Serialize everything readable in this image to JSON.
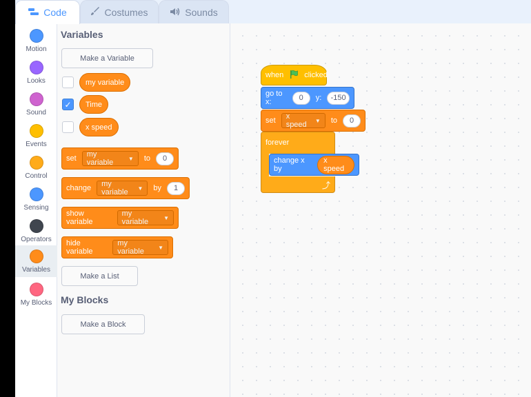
{
  "tabs": [
    {
      "label": "Code",
      "icon": "code-icon",
      "active": true
    },
    {
      "label": "Costumes",
      "icon": "brush-icon",
      "active": false
    },
    {
      "label": "Sounds",
      "icon": "speaker-icon",
      "active": false
    }
  ],
  "categories": [
    {
      "label": "Motion",
      "color": "#4c97ff"
    },
    {
      "label": "Looks",
      "color": "#9966ff"
    },
    {
      "label": "Sound",
      "color": "#cf63cf"
    },
    {
      "label": "Events",
      "color": "#ffbf00"
    },
    {
      "label": "Control",
      "color": "#ffab19"
    },
    {
      "label": "Sensing",
      "color": "#5cb1d6"
    },
    {
      "label": "Operators",
      "color": "#40464f"
    },
    {
      "label": "Variables",
      "color": "#ff8c1a"
    },
    {
      "label": "My Blocks",
      "color": "#ff6680"
    }
  ],
  "palette": {
    "variables_title": "Variables",
    "make_variable": "Make a Variable",
    "vars": [
      {
        "name": "my variable",
        "checked": false
      },
      {
        "name": "Time",
        "checked": true
      },
      {
        "name": "x speed",
        "checked": false
      }
    ],
    "set_block": {
      "label": "set",
      "var": "my variable",
      "to": "to",
      "value": "0"
    },
    "change_block": {
      "label": "change",
      "var": "my variable",
      "by": "by",
      "value": "1"
    },
    "show_block": {
      "label": "show variable",
      "var": "my variable"
    },
    "hide_block": {
      "label": "hide variable",
      "var": "my variable"
    },
    "make_list": "Make a List",
    "myblocks_title": "My Blocks",
    "make_block": "Make a Block"
  },
  "script": {
    "hat": {
      "when": "when",
      "clicked": "clicked"
    },
    "goto": {
      "label": "go to x:",
      "x": "0",
      "ylabel": "y:",
      "y": "-150"
    },
    "set": {
      "label": "set",
      "var": "x speed",
      "to": "to",
      "value": "0"
    },
    "forever": "forever",
    "change_x": {
      "label": "change x by",
      "value": "x speed"
    }
  }
}
